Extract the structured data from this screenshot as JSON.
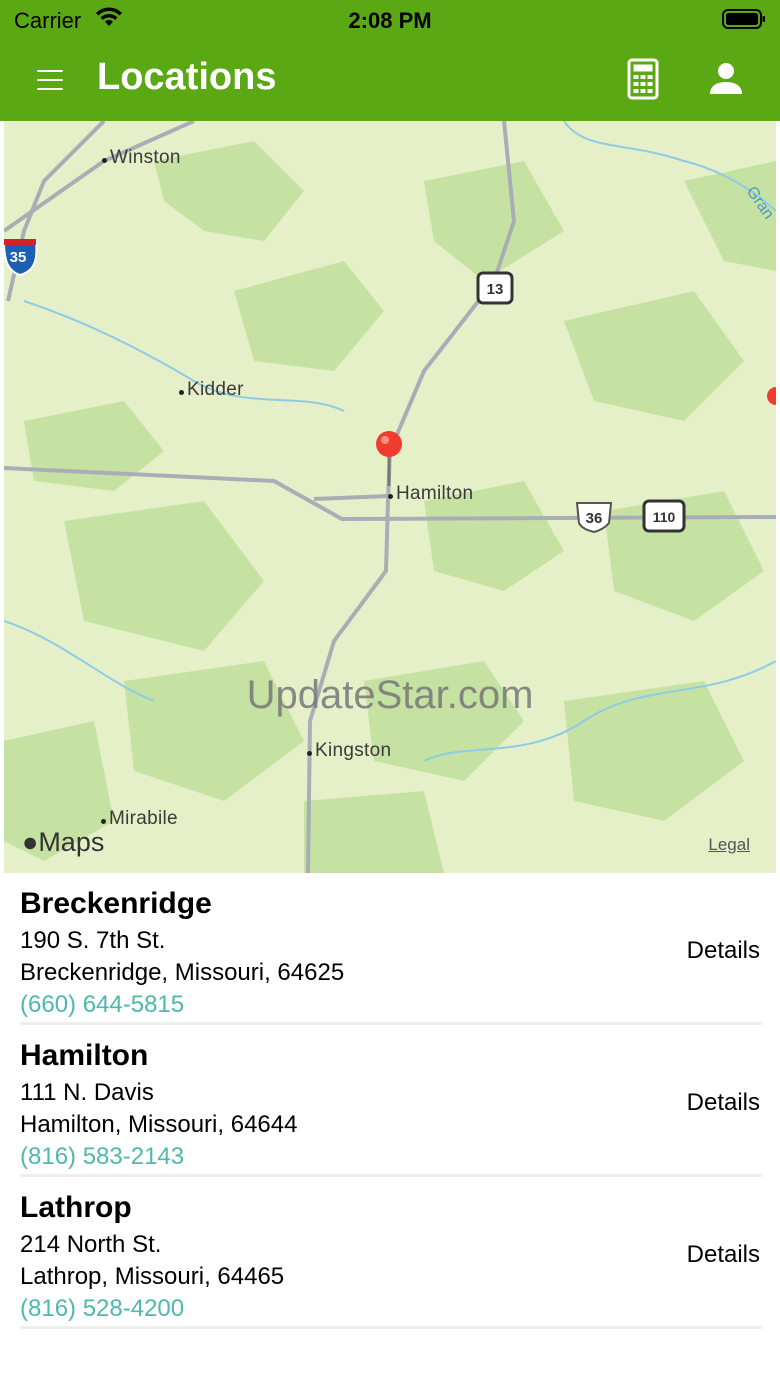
{
  "status_bar": {
    "carrier": "Carrier",
    "time": "2:08 PM"
  },
  "header": {
    "title": "Locations",
    "menu_icon": "hamburger-menu-icon",
    "calculator_icon": "calculator-icon",
    "user_icon": "user-icon",
    "brand_color": "#5aa813"
  },
  "map": {
    "places": [
      "Winston",
      "Kidder",
      "Hamilton",
      "Kingston",
      "Mirabile"
    ],
    "route_shields": [
      "35",
      "13",
      "36",
      "110"
    ],
    "river_label": "Gran",
    "watermark": "UpdateStar.com",
    "logo": "Maps",
    "legal": "Legal"
  },
  "locations": [
    {
      "name": "Breckenridge",
      "address_line1": "190 S. 7th St.",
      "address_line2": "Breckenridge, Missouri, 64625",
      "phone": "(660) 644-5815",
      "details_label": "Details"
    },
    {
      "name": "Hamilton",
      "address_line1": "111 N. Davis",
      "address_line2": "Hamilton, Missouri, 64644",
      "phone": "(816) 583-2143",
      "details_label": "Details"
    },
    {
      "name": "Lathrop",
      "address_line1": "214 North St.",
      "address_line2": "Lathrop, Missouri, 64465",
      "phone": "(816) 528-4200",
      "details_label": "Details"
    }
  ],
  "colors": {
    "phone_link": "#4db8ad",
    "map_land": "#e5f0c8",
    "map_forest": "#c6e2a3",
    "pin": "#f03c2f"
  }
}
